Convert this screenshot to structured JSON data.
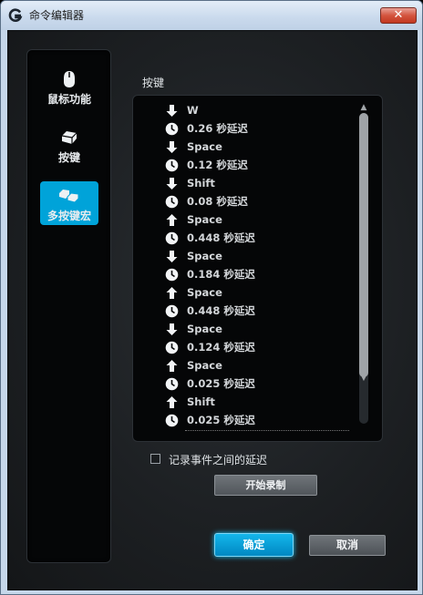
{
  "window": {
    "title": "命令编辑器",
    "close_symbol": "✕"
  },
  "sidebar": {
    "items": [
      {
        "label": "鼠标功能",
        "icon": "mouse-icon",
        "active": false
      },
      {
        "label": "按键",
        "icon": "key-icon",
        "active": false
      },
      {
        "label": "多按键宏",
        "icon": "multi-key-icon",
        "active": true
      }
    ]
  },
  "keystrokes": {
    "label": "按键",
    "events": [
      {
        "icon": "arrow-down-icon",
        "text": "W"
      },
      {
        "icon": "clock-icon",
        "text": "0.26 秒延迟"
      },
      {
        "icon": "arrow-down-icon",
        "text": "Space"
      },
      {
        "icon": "clock-icon",
        "text": "0.12 秒延迟"
      },
      {
        "icon": "arrow-down-icon",
        "text": "Shift"
      },
      {
        "icon": "clock-icon",
        "text": "0.08 秒延迟"
      },
      {
        "icon": "arrow-up-icon",
        "text": "Space"
      },
      {
        "icon": "clock-icon",
        "text": "0.448 秒延迟"
      },
      {
        "icon": "arrow-down-icon",
        "text": "Space"
      },
      {
        "icon": "clock-icon",
        "text": "0.184 秒延迟"
      },
      {
        "icon": "arrow-up-icon",
        "text": "Space"
      },
      {
        "icon": "clock-icon",
        "text": "0.448 秒延迟"
      },
      {
        "icon": "arrow-down-icon",
        "text": "Space"
      },
      {
        "icon": "clock-icon",
        "text": "0.124 秒延迟"
      },
      {
        "icon": "arrow-up-icon",
        "text": "Space"
      },
      {
        "icon": "clock-icon",
        "text": "0.025 秒延迟"
      },
      {
        "icon": "arrow-up-icon",
        "text": "Shift"
      },
      {
        "icon": "clock-icon",
        "text": "0.025 秒延迟"
      }
    ]
  },
  "record_delays": {
    "label": "记录事件之间的延迟",
    "checked": false
  },
  "buttons": {
    "record": "开始录制",
    "ok": "确定",
    "cancel": "取消"
  },
  "colors": {
    "accent": "#00a3d9",
    "panel": "#050607",
    "text": "#d4d7da"
  }
}
